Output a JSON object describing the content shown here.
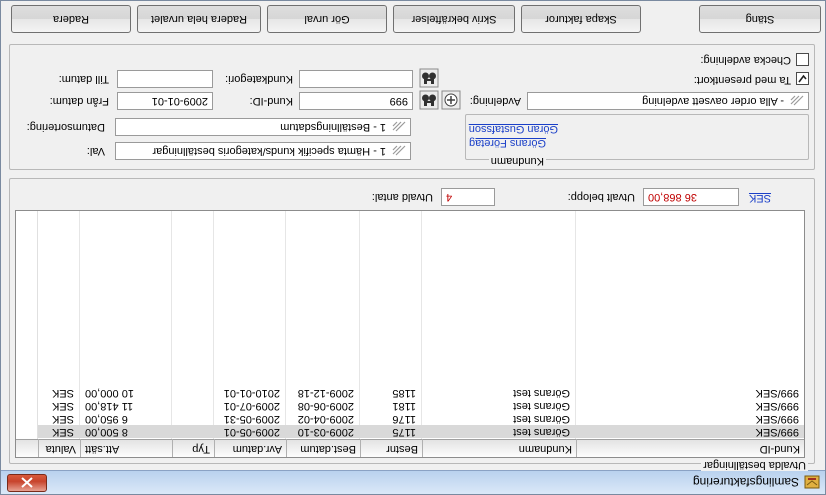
{
  "window": {
    "title": "Samlingsfakturering",
    "close_glyph": "✕"
  },
  "orders": {
    "legend": "Utvalda beställningar",
    "columns": [
      "Kund-ID",
      "Kundnamn",
      "Bestnr",
      "Best.datum",
      "Avr.datum",
      "Typ",
      " Att.sätt",
      "Valuta"
    ],
    "rows": [
      [
        "999/SEK",
        "Görans test",
        "1175",
        "2009-03-10",
        "2009-05-01",
        "",
        "8 500,00",
        "SEK"
      ],
      [
        "999/SEK",
        "Görans test",
        "1176",
        "2009-04-02",
        "2009-05-31",
        "",
        "6 950,00",
        "SEK"
      ],
      [
        "999/SEK",
        "Görans test",
        "1181",
        "2009-06-08",
        "2009-07-01",
        "",
        "11 418,00",
        "SEK"
      ],
      [
        "999/SEK",
        "Görans test",
        "1185",
        "2009-12-18",
        "2010-01-01",
        "",
        "10 000,00",
        "SEK"
      ]
    ],
    "selected_row": 0,
    "summary": {
      "count_label": "Utvald antal:",
      "count_value": "4",
      "amount_label": "Utvalt belopp:",
      "amount_value": "36 868,00",
      "currency": "SEK"
    }
  },
  "filters": {
    "val_label": "Val:",
    "val_value": "1 - Hämta specifik kunds/kategoris beställningar",
    "sort_label": "Datumsortering:",
    "sort_value": "1 - Beställningsdatum",
    "from_label": "Från datum:",
    "from_value": "2009-01-01",
    "to_label": "Till datum:",
    "to_value": "",
    "kundid_label": "Kund-ID:",
    "kundid_value": "999",
    "kategori_label": "Kundkategori:",
    "kategori_value": "",
    "kundnamn_legend": "Kundnamn",
    "kundnamn_items": [
      "Görans Företag",
      "Göran Gustafsson"
    ],
    "avdelning_label": "Avdelning:",
    "avdelning_value": "- Alla order oavsett avdelning",
    "presentkort_label": "Ta med presentkort:",
    "presentkort_checked": true,
    "checka_label": "Checka avdelning:",
    "checka_checked": false
  },
  "buttons": {
    "radera": "Radera",
    "radera_hela": "Radera hela urvalet",
    "gor_urval": "Gör urval",
    "skriv": "Skriv bekräftelser",
    "skapa": "Skapa fakturor",
    "stang": "Stäng"
  },
  "colors": {
    "amount_text": "#c00000",
    "link_text": "#1a3fc8",
    "selected_row_bg": "#d9d9d9"
  }
}
